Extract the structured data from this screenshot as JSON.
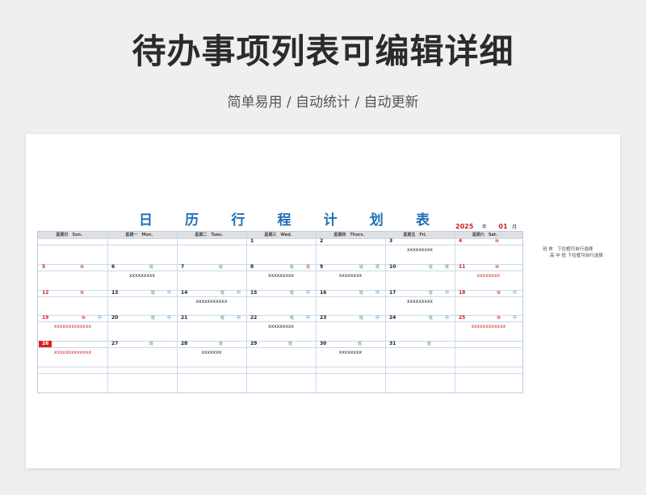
{
  "title": "待办事项列表可编辑详细",
  "subtitle": "简单易用 / 自动统计 / 自动更新",
  "calendar": {
    "title_chars": [
      "日",
      "历",
      "行",
      "程",
      "计",
      "划",
      "表"
    ],
    "year": "2025",
    "year_unit": "年",
    "month": "01",
    "month_unit": "月",
    "weekdays": [
      "星期日　Sun.",
      "星期一　Mon.",
      "星期二　Tues.",
      "星期三　Wed.",
      "星期四　Thurs.",
      "星期五　Fri.",
      "星期六　Sat."
    ],
    "notes": [
      "班 休　下拉框可自行选择",
      "高 中 低 下拉框可自行选择"
    ],
    "weeks": [
      [
        {
          "d": ""
        },
        {
          "d": ""
        },
        {
          "d": ""
        },
        {
          "d": "1"
        },
        {
          "d": "2"
        },
        {
          "d": "3",
          "todo": "xxxxxxxxx"
        },
        {
          "d": "4",
          "red": true,
          "tag": "休",
          "tagc": "xiu"
        }
      ],
      [
        {
          "d": "5",
          "red": true,
          "tag": "休",
          "tagc": "xiu"
        },
        {
          "d": "6",
          "tag": "班",
          "tagc": "ban",
          "todo": "xxxxxxxxx"
        },
        {
          "d": "7",
          "tag": "班",
          "tagc": "ban"
        },
        {
          "d": "8",
          "tag": "班",
          "tagc": "ban",
          "tag2": "低",
          "tag2c": "xiu",
          "todo": "xxxxxxxxx"
        },
        {
          "d": "9",
          "tag": "班",
          "tagc": "ban",
          "tag2": "低",
          "tag2c": "ban",
          "todo": "xxxxxxxx"
        },
        {
          "d": "10",
          "tag": "班",
          "tagc": "ban",
          "tag2": "低",
          "tag2c": "ban"
        },
        {
          "d": "11",
          "red": true,
          "tag": "休",
          "tagc": "xiu",
          "todo": "xxxxxxxx",
          "todoRed": true
        }
      ],
      [
        {
          "d": "12",
          "red": true,
          "tag": "休",
          "tagc": "xiu"
        },
        {
          "d": "13",
          "tag": "班",
          "tagc": "ban",
          "tag2": "中",
          "tag2c": "zhong"
        },
        {
          "d": "14",
          "tag": "班",
          "tagc": "ban",
          "tag2": "中",
          "tag2c": "zhong",
          "todo": "xxxxxxxxxxx"
        },
        {
          "d": "15",
          "tag": "班",
          "tagc": "ban",
          "tag2": "中",
          "tag2c": "zhong"
        },
        {
          "d": "16",
          "tag": "班",
          "tagc": "ban",
          "tag2": "中",
          "tag2c": "zhong"
        },
        {
          "d": "17",
          "tag": "班",
          "tagc": "ban",
          "tag2": "中",
          "tag2c": "zhong",
          "todo": "xxxxxxxxx"
        },
        {
          "d": "18",
          "red": true,
          "tag": "休",
          "tagc": "xiu",
          "tag2": "中",
          "tag2c": "zhong"
        }
      ],
      [
        {
          "d": "19",
          "red": true,
          "tag": "休",
          "tagc": "xiu",
          "tag2": "中",
          "tag2c": "zhong",
          "todo": "xxxxxxxxxxxxx",
          "todoRed": true
        },
        {
          "d": "20",
          "tag": "班",
          "tagc": "ban",
          "tag2": "中",
          "tag2c": "zhong"
        },
        {
          "d": "21",
          "tag": "班",
          "tagc": "ban",
          "tag2": "中",
          "tag2c": "zhong"
        },
        {
          "d": "22",
          "tag": "班",
          "tagc": "ban",
          "tag2": "中",
          "tag2c": "zhong",
          "todo": "xxxxxxxxx"
        },
        {
          "d": "23",
          "tag": "班",
          "tagc": "ban",
          "tag2": "中",
          "tag2c": "zhong"
        },
        {
          "d": "24",
          "tag": "班",
          "tagc": "ban",
          "tag2": "中",
          "tag2c": "zhong"
        },
        {
          "d": "25",
          "red": true,
          "tag": "休",
          "tagc": "xiu",
          "tag2": "中",
          "tag2c": "zhong",
          "todo": "xxxxxxxxxxxx",
          "todoRed": true
        }
      ],
      [
        {
          "d": "26",
          "today": true,
          "todo": "xxxxxxxxxxxxx",
          "todoRed": true
        },
        {
          "d": "27",
          "tag": "班",
          "tagc": "ban"
        },
        {
          "d": "28",
          "tag": "班",
          "tagc": "ban",
          "todo": "xxxxxxx"
        },
        {
          "d": "29",
          "tag": "班",
          "tagc": "ban"
        },
        {
          "d": "30",
          "tag": "班",
          "tagc": "ban",
          "todo": "xxxxxxxx"
        },
        {
          "d": "31",
          "tag": "班",
          "tagc": "ban"
        },
        {
          "d": ""
        }
      ],
      [
        {
          "d": ""
        },
        {
          "d": ""
        },
        {
          "d": ""
        },
        {
          "d": ""
        },
        {
          "d": ""
        },
        {
          "d": ""
        },
        {
          "d": ""
        }
      ]
    ]
  }
}
